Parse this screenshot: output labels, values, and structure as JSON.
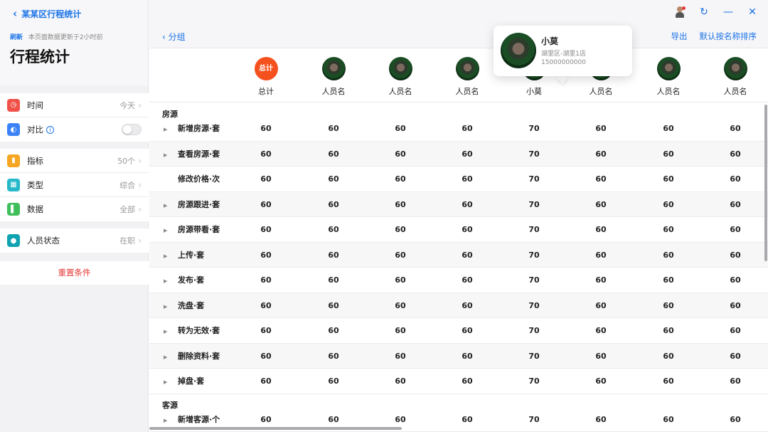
{
  "sidebar": {
    "back_label": "某某区行程统计",
    "refresh_link": "刷新",
    "refresh_note": "本页面数据更新于2小时前",
    "title": "行程统计",
    "filters": [
      {
        "label": "时间",
        "value": "今天",
        "color": "#f0524a"
      },
      {
        "label": "对比",
        "value": "",
        "color": "#3b82f6"
      }
    ],
    "metrics": [
      {
        "label": "指标",
        "value": "50个",
        "color": "#f5a623"
      },
      {
        "label": "类型",
        "value": "综合",
        "color": "#26b8c9"
      },
      {
        "label": "数据",
        "value": "全部",
        "color": "#3fbf5a"
      }
    ],
    "status": [
      {
        "label": "人员状态",
        "value": "在职",
        "color": "#0fa3b1"
      }
    ],
    "reset_label": "重置条件"
  },
  "toolbar": {
    "group_back": "分组",
    "export": "导出",
    "sort": "默认按名称排序"
  },
  "columns": [
    {
      "name": "总计",
      "badge": "总计"
    },
    {
      "name": "人员名"
    },
    {
      "name": "人员名"
    },
    {
      "name": "人员名"
    },
    {
      "name": "小莫"
    },
    {
      "name": "人员名"
    },
    {
      "name": "人员名"
    },
    {
      "name": "人员名"
    }
  ],
  "sections": [
    {
      "title": "房源",
      "rows": [
        {
          "name": "新增房源·套",
          "expandable": true,
          "values": [
            "60",
            "60",
            "60",
            "60",
            "70",
            "60",
            "60",
            "60"
          ]
        },
        {
          "name": "查看房源·套",
          "expandable": true,
          "values": [
            "60",
            "60",
            "60",
            "60",
            "70",
            "60",
            "60",
            "60"
          ]
        },
        {
          "name": "修改价格·次",
          "expandable": false,
          "values": [
            "60",
            "60",
            "60",
            "60",
            "70",
            "60",
            "60",
            "60"
          ]
        },
        {
          "name": "房源跟进·套",
          "expandable": true,
          "values": [
            "60",
            "60",
            "60",
            "60",
            "70",
            "60",
            "60",
            "60"
          ]
        },
        {
          "name": "房源带看·套",
          "expandable": true,
          "values": [
            "60",
            "60",
            "60",
            "60",
            "70",
            "60",
            "60",
            "60"
          ]
        },
        {
          "name": "上传·套",
          "expandable": true,
          "values": [
            "60",
            "60",
            "60",
            "60",
            "70",
            "60",
            "60",
            "60"
          ]
        },
        {
          "name": "发布·套",
          "expandable": true,
          "values": [
            "60",
            "60",
            "60",
            "60",
            "70",
            "60",
            "60",
            "60"
          ]
        },
        {
          "name": "洗盘·套",
          "expandable": true,
          "values": [
            "60",
            "60",
            "60",
            "60",
            "70",
            "60",
            "60",
            "60"
          ]
        },
        {
          "name": "转为无效·套",
          "expandable": true,
          "values": [
            "60",
            "60",
            "60",
            "60",
            "70",
            "60",
            "60",
            "60"
          ]
        },
        {
          "name": "删除资料·套",
          "expandable": true,
          "values": [
            "60",
            "60",
            "60",
            "60",
            "70",
            "60",
            "60",
            "60"
          ]
        },
        {
          "name": "掉盘·套",
          "expandable": true,
          "values": [
            "60",
            "60",
            "60",
            "60",
            "70",
            "60",
            "60",
            "60"
          ]
        }
      ]
    },
    {
      "title": "客源",
      "rows": [
        {
          "name": "新增客源·个",
          "expandable": true,
          "values": [
            "60",
            "60",
            "60",
            "60",
            "70",
            "60",
            "60",
            "60"
          ]
        }
      ]
    }
  ],
  "popup": {
    "name": "小莫",
    "store": "湖里区-湖里1店",
    "phone": "15000000000"
  }
}
